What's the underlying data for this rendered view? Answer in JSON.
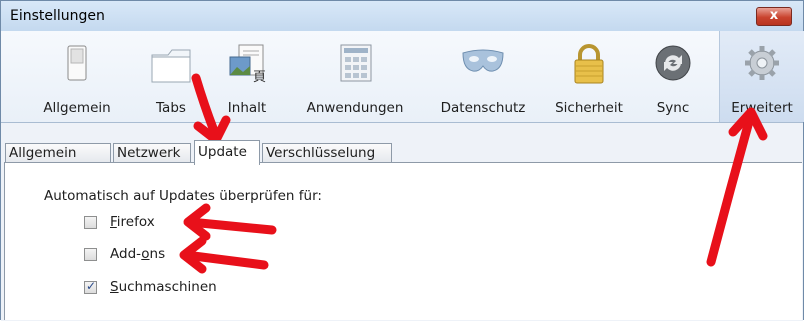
{
  "window": {
    "title": "Einstellungen",
    "close_label": "x"
  },
  "toolbar": {
    "items": [
      {
        "label": "Allgemein",
        "icon": "switch-icon"
      },
      {
        "label": "Tabs",
        "icon": "tabs-icon"
      },
      {
        "label": "Inhalt",
        "icon": "content-icon"
      },
      {
        "label": "Anwendungen",
        "icon": "applications-icon"
      },
      {
        "label": "Datenschutz",
        "icon": "mask-icon"
      },
      {
        "label": "Sicherheit",
        "icon": "lock-icon"
      },
      {
        "label": "Sync",
        "icon": "sync-icon"
      },
      {
        "label": "Erweitert",
        "icon": "gear-icon",
        "selected": true
      }
    ]
  },
  "tabs": [
    {
      "label": "Allgemein"
    },
    {
      "label": "Netzwerk"
    },
    {
      "label": "Update",
      "active": true
    },
    {
      "label": "Verschlüsselung"
    }
  ],
  "update": {
    "heading": "Automatisch auf Updates überprüfen für:",
    "options": [
      {
        "accesskey": "F",
        "label_rest": "irefox",
        "checked": false
      },
      {
        "label_pre": "Add-",
        "accesskey": "o",
        "label_rest": "ns",
        "checked": false
      },
      {
        "accesskey": "S",
        "label_rest": "uchmaschinen",
        "checked": true
      }
    ]
  },
  "colors": {
    "arrow": "#e8101a",
    "selected_pane": "#cddcef"
  }
}
